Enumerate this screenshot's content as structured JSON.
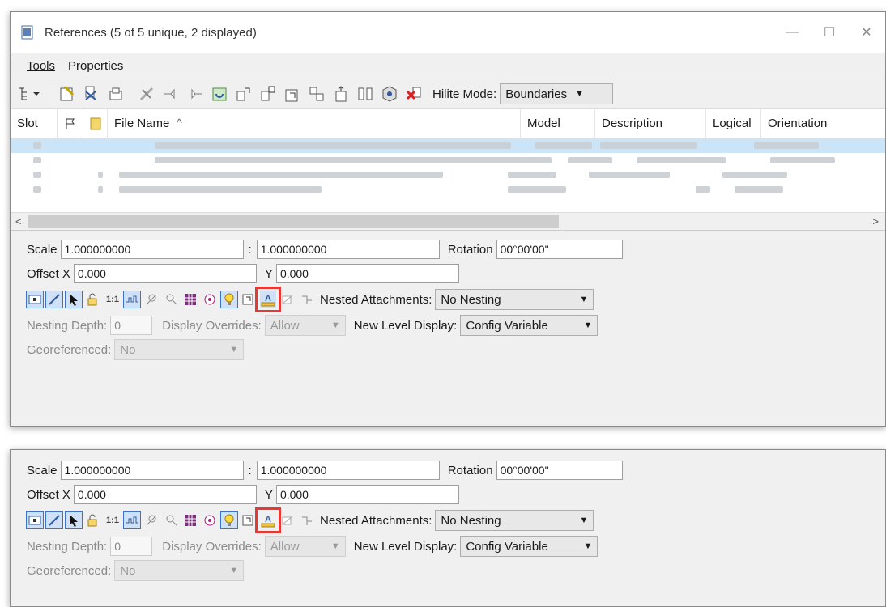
{
  "window": {
    "title": "References (5 of 5 unique, 2 displayed)",
    "controls": {
      "minimize": "—",
      "maximize": "☐",
      "close": "✕"
    }
  },
  "menu": {
    "tools": "Tools",
    "properties": "Properties"
  },
  "toolbar": {
    "hilite_label": "Hilite Mode:",
    "hilite_value": "Boundaries",
    "icons": [
      "tree-view-icon",
      "attach-icon",
      "detach-icon",
      "reload-icon",
      "exchange-icon",
      "clip-boundary-icon",
      "clip-mask-icon",
      "delete-clip-icon",
      "rotate-icon",
      "move-icon",
      "scale-icon",
      "copy-icon",
      "mirror-h-icon",
      "mirror-v-icon",
      "merge-icon",
      "settings-icon",
      "clear-icon"
    ]
  },
  "grid": {
    "columns": {
      "slot": "Slot",
      "file_name": "File Name",
      "sort_indicator": "^",
      "model": "Model",
      "description": "Description",
      "logical": "Logical",
      "orientation": "Orientation"
    },
    "scroll_left": "<",
    "scroll_right": ">"
  },
  "settings_top": {
    "scale_label": "Scale",
    "scale_value1": "1.000000000",
    "scale_sep": ":",
    "scale_value2": "1.000000000",
    "rotation_label": "Rotation",
    "rotation_value": "00°00'00\"",
    "offset_x_label": "Offset X",
    "offset_x_value": "0.000",
    "offset_y_label": "Y",
    "offset_y_value": "0.000",
    "nested_label": "Nested Attachments:",
    "nested_value": "No Nesting",
    "nesting_depth_label": "Nesting Depth:",
    "nesting_depth_value": "0",
    "display_overrides_label": "Display Overrides:",
    "display_overrides_value": "Allow",
    "new_level_label": "New Level Display:",
    "new_level_value": "Config Variable",
    "georef_label": "Georeferenced:",
    "georef_value": "No",
    "icon_11": "1:1"
  },
  "settings_bottom": {
    "scale_label": "Scale",
    "scale_value1": "1.000000000",
    "scale_sep": ":",
    "scale_value2": "1.000000000",
    "rotation_label": "Rotation",
    "rotation_value": "00°00'00\"",
    "offset_x_label": "Offset X",
    "offset_x_value": "0.000",
    "offset_y_label": "Y",
    "offset_y_value": "0.000",
    "nested_label": "Nested Attachments:",
    "nested_value": "No Nesting",
    "nesting_depth_label": "Nesting Depth:",
    "nesting_depth_value": "0",
    "display_overrides_label": "Display Overrides:",
    "display_overrides_value": "Allow",
    "new_level_label": "New Level Display:",
    "new_level_value": "Config Variable",
    "georef_label": "Georeferenced:",
    "georef_value": "No",
    "icon_11": "1:1"
  },
  "colors": {
    "highlight": "#e53935",
    "selected_row": "#cce4f7",
    "accent": "#3b73c8"
  }
}
